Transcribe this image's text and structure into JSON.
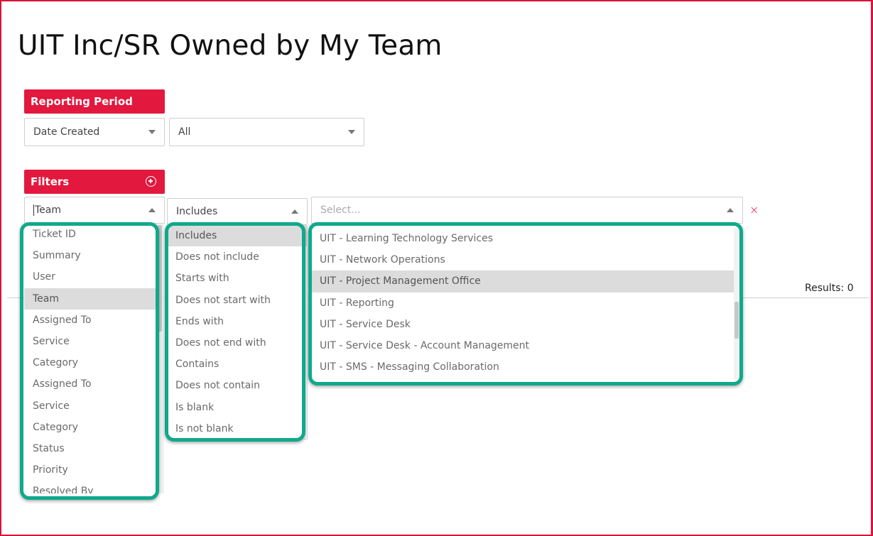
{
  "page": {
    "title": "UIT Inc/SR Owned by My Team"
  },
  "reporting_period": {
    "header": "Reporting Period",
    "date_field": "Date Created",
    "range": "All"
  },
  "filters": {
    "header": "Filters",
    "field_value": "Team",
    "operator_value": "Includes",
    "value_placeholder": "Select...",
    "clear_symbol": "×",
    "field_options": [
      "Ticket ID",
      "Summary",
      "User",
      "Team",
      "Assigned To",
      "Service",
      "Category",
      "Assigned To",
      "Service",
      "Category",
      "Status",
      "Priority",
      "Resolved By"
    ],
    "field_selected_index": 3,
    "operator_options": [
      "Includes",
      "Does not include",
      "Starts with",
      "Does not start with",
      "Ends with",
      "Does not end with",
      "Contains",
      "Does not contain",
      "Is blank",
      "Is not blank"
    ],
    "operator_selected_index": 0,
    "value_options": [
      "UIT - Learning Technology Services",
      "UIT - Network Operations",
      "UIT - Project Management Office",
      "UIT - Reporting",
      "UIT - Service Desk",
      "UIT - Service Desk - Account Management",
      "UIT - SMS - Messaging Collaboration"
    ],
    "value_highlighted_index": 2
  },
  "results": {
    "label": "Results: 0"
  },
  "colors": {
    "accent": "#e3183e",
    "highlight": "#0fa98c",
    "selected_row": "#dcdcdc"
  }
}
